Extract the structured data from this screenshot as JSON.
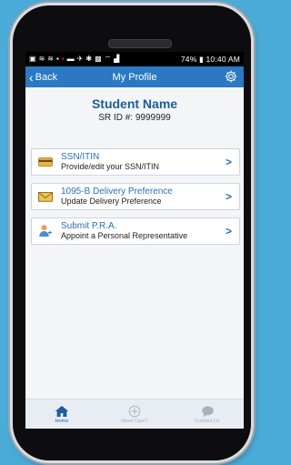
{
  "status_bar": {
    "battery": "74%",
    "time": "10:40 AM"
  },
  "nav": {
    "back_label": "Back",
    "title": "My Profile"
  },
  "profile": {
    "name": "Student Name",
    "sr_id": "SR ID #: 9999999"
  },
  "options": [
    {
      "title": "SSN/ITIN",
      "subtitle": "Provide/edit your SSN/ITIN",
      "icon": "id-card-icon"
    },
    {
      "title": "1095-B Delivery Preference",
      "subtitle": "Update Delivery Preference",
      "icon": "envelope-icon"
    },
    {
      "title": "Submit P.R.A.",
      "subtitle": "Appoint a Personal Representative",
      "icon": "person-icon"
    }
  ],
  "tabs": [
    {
      "label": "Home",
      "icon": "home-icon",
      "active": true
    },
    {
      "label": "Need Care?",
      "icon": "plus-circle-icon",
      "active": false
    },
    {
      "label": "Contact Us",
      "icon": "chat-icon",
      "active": false
    }
  ],
  "colors": {
    "accent": "#2a79c2",
    "name_text": "#1f5c99",
    "background": "#4aaad8"
  }
}
